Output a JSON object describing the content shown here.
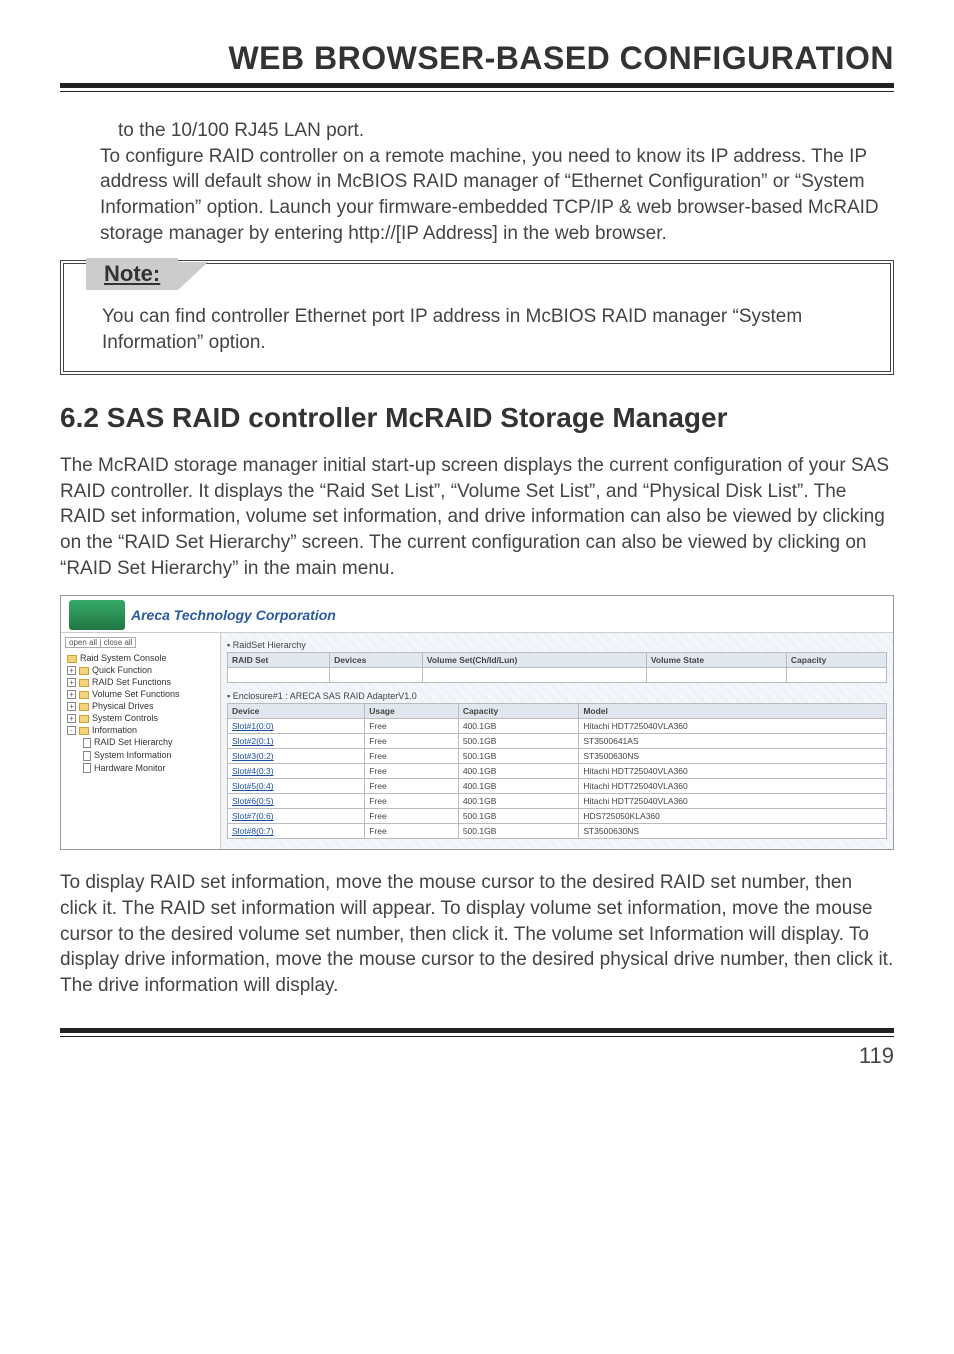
{
  "header": {
    "title": "WEB BROWSER-BASED CONFIGURATION"
  },
  "para1_line": "to the 10/100 RJ45 LAN port.",
  "para1_rest": "To configure RAID controller on a remote machine, you need to know its IP address. The IP address will default show in McBIOS RAID manager of “Ethernet Configuration” or “System Information” option. Launch your firmware-embedded TCP/IP & web browser-based McRAID storage manager by entering http://[IP Address] in the web browser.",
  "note": {
    "label": "Note:",
    "body": "You can find controller Ethernet port IP address in McBIOS RAID manager “System Information” option."
  },
  "section_heading": "6.2 SAS RAID controller McRAID Storage Manager",
  "intro": "The McRAID storage manager initial start-up screen displays the current configuration of your SAS RAID controller. It displays the “Raid Set List”, “Volume Set List”, and “Physical Disk List”. The RAID set information, volume set information, and drive information can also be viewed by clicking on the “RAID Set Hierarchy” screen. The current configuration can also be viewed by clicking on “RAID Set Hierarchy” in the main menu.",
  "shot": {
    "banner": "Areca Technology Corporation",
    "sidebar": {
      "controls": {
        "open": "open all",
        "close": "close all"
      },
      "root": "Raid System Console",
      "items": [
        "Quick Function",
        "RAID Set Functions",
        "Volume Set Functions",
        "Physical Drives",
        "System Controls",
        "Information"
      ],
      "info_children": [
        "RAID Set Hierarchy",
        "System Information",
        "Hardware Monitor"
      ]
    },
    "hierarchy": {
      "title": "▪ RaidSet Hierarchy",
      "headers": [
        "RAID Set",
        "Devices",
        "Volume Set(Ch/Id/Lun)",
        "Volume State",
        "Capacity"
      ]
    },
    "enclosure": {
      "title": "▪ Enclosure#1 : ARECA SAS RAID AdapterV1.0",
      "headers": [
        "Device",
        "Usage",
        "Capacity",
        "Model"
      ],
      "rows": [
        {
          "device": "Slot#1(0:0)",
          "usage": "Free",
          "capacity": "400.1GB",
          "model": "Hitachi HDT725040VLA360"
        },
        {
          "device": "Slot#2(0:1)",
          "usage": "Free",
          "capacity": "500.1GB",
          "model": "ST3500641AS"
        },
        {
          "device": "Slot#3(0:2)",
          "usage": "Free",
          "capacity": "500.1GB",
          "model": "ST3500630NS"
        },
        {
          "device": "Slot#4(0:3)",
          "usage": "Free",
          "capacity": "400.1GB",
          "model": "Hitachi HDT725040VLA360"
        },
        {
          "device": "Slot#5(0:4)",
          "usage": "Free",
          "capacity": "400.1GB",
          "model": "Hitachi HDT725040VLA360"
        },
        {
          "device": "Slot#6(0:5)",
          "usage": "Free",
          "capacity": "400.1GB",
          "model": "Hitachi HDT725040VLA360"
        },
        {
          "device": "Slot#7(0:6)",
          "usage": "Free",
          "capacity": "500.1GB",
          "model": "HDS725050KLA360"
        },
        {
          "device": "Slot#8(0:7)",
          "usage": "Free",
          "capacity": "500.1GB",
          "model": "ST3500630NS"
        }
      ]
    }
  },
  "outro": "To display RAID set information, move the mouse cursor to the desired RAID set number, then click it. The RAID set information will appear. To display volume set information, move the mouse cursor to the desired volume set number, then click it. The volume set Information will display. To display drive information, move the mouse cursor to the desired physical drive number, then click it. The drive information will display.",
  "page_number": "119"
}
